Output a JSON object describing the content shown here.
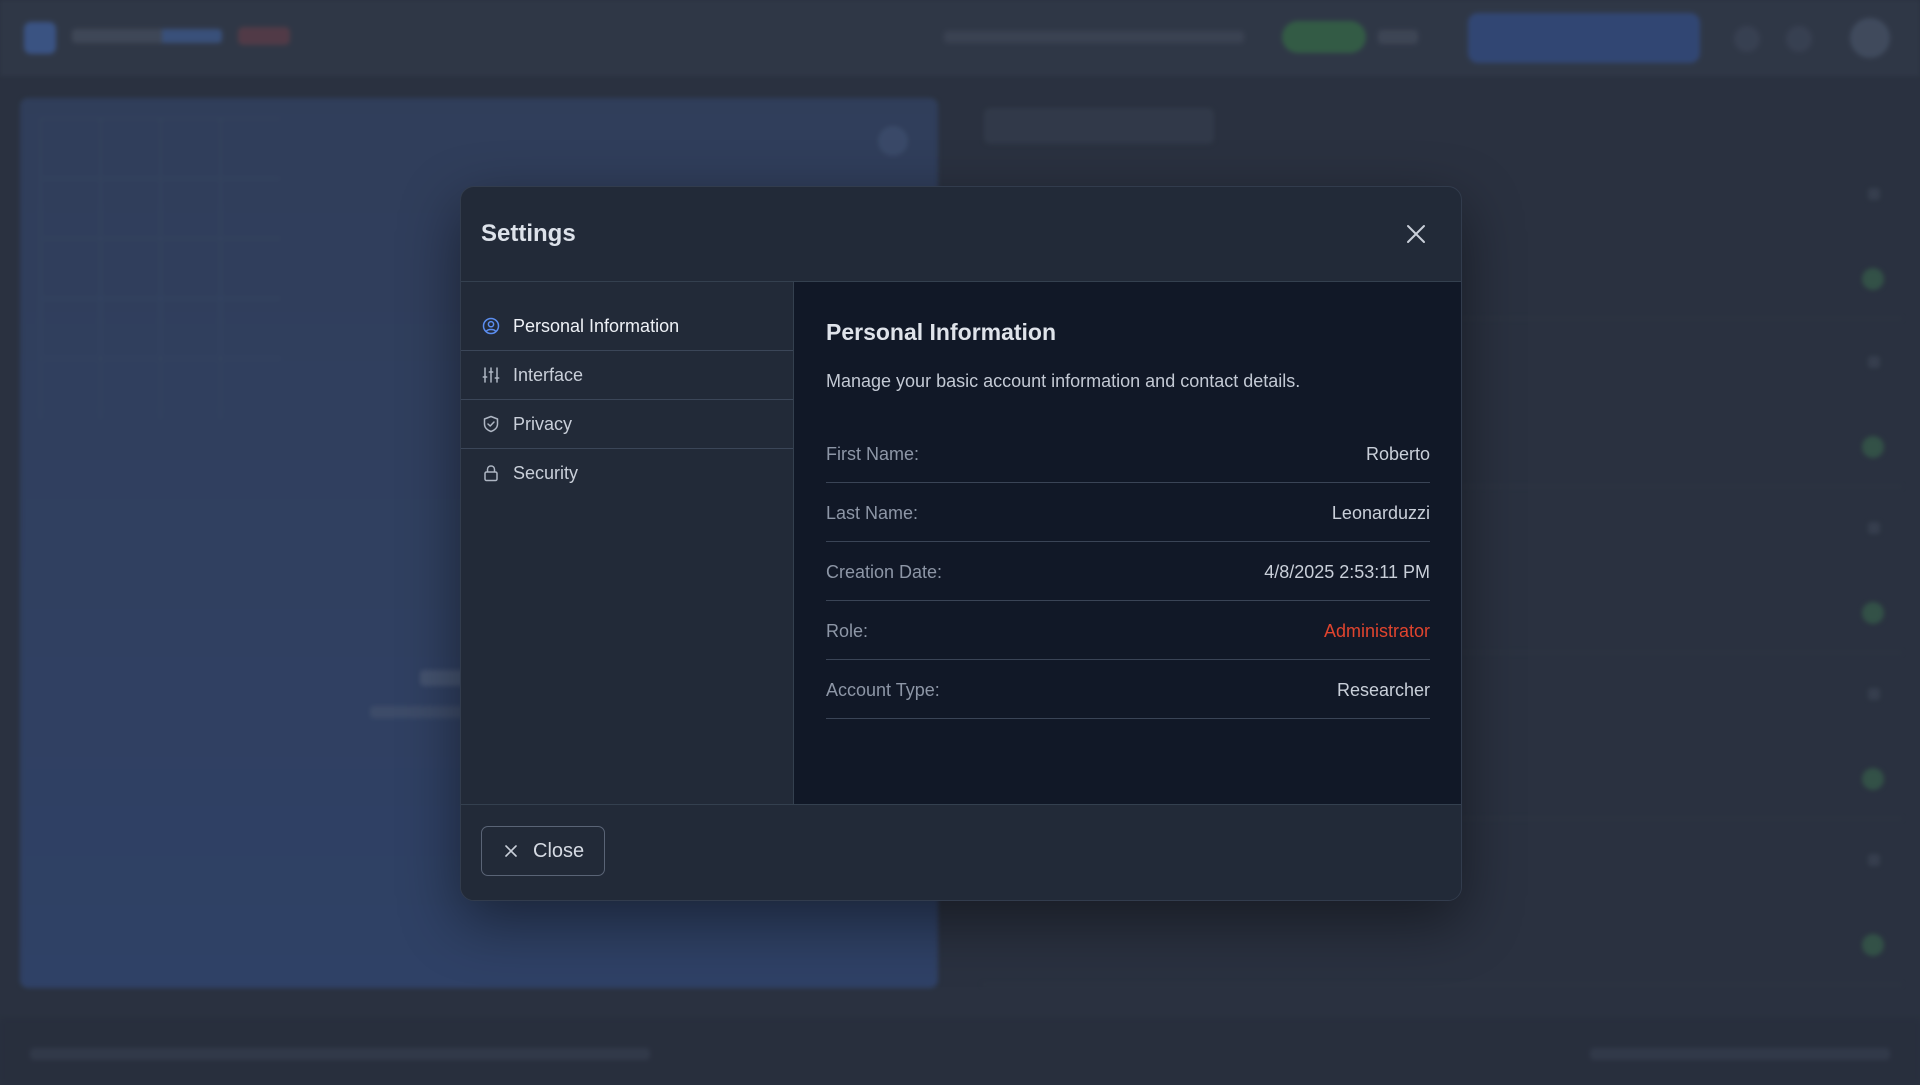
{
  "dialog": {
    "title": "Settings",
    "footer_close_label": "Close"
  },
  "sidebar": {
    "items": [
      {
        "label": "Personal Information",
        "icon": "user-circle-icon",
        "active": true
      },
      {
        "label": "Interface",
        "icon": "sliders-icon",
        "active": false
      },
      {
        "label": "Privacy",
        "icon": "shield-check-icon",
        "active": false
      },
      {
        "label": "Security",
        "icon": "lock-icon",
        "active": false
      }
    ]
  },
  "content": {
    "title": "Personal Information",
    "description": "Manage your basic account information and contact details.",
    "fields": [
      {
        "label": "First Name:",
        "value": "Roberto"
      },
      {
        "label": "Last Name:",
        "value": "Leonarduzzi"
      },
      {
        "label": "Creation Date:",
        "value": "4/8/2025 2:53:11 PM"
      },
      {
        "label": "Role:",
        "value": "Administrator",
        "accent": "#e0442e"
      },
      {
        "label": "Account Type:",
        "value": "Researcher"
      }
    ]
  },
  "colors": {
    "accent_blue": "#5b8def",
    "role_accent": "#e0442e",
    "modal_bg": "#222a38",
    "content_bg": "#111827"
  }
}
